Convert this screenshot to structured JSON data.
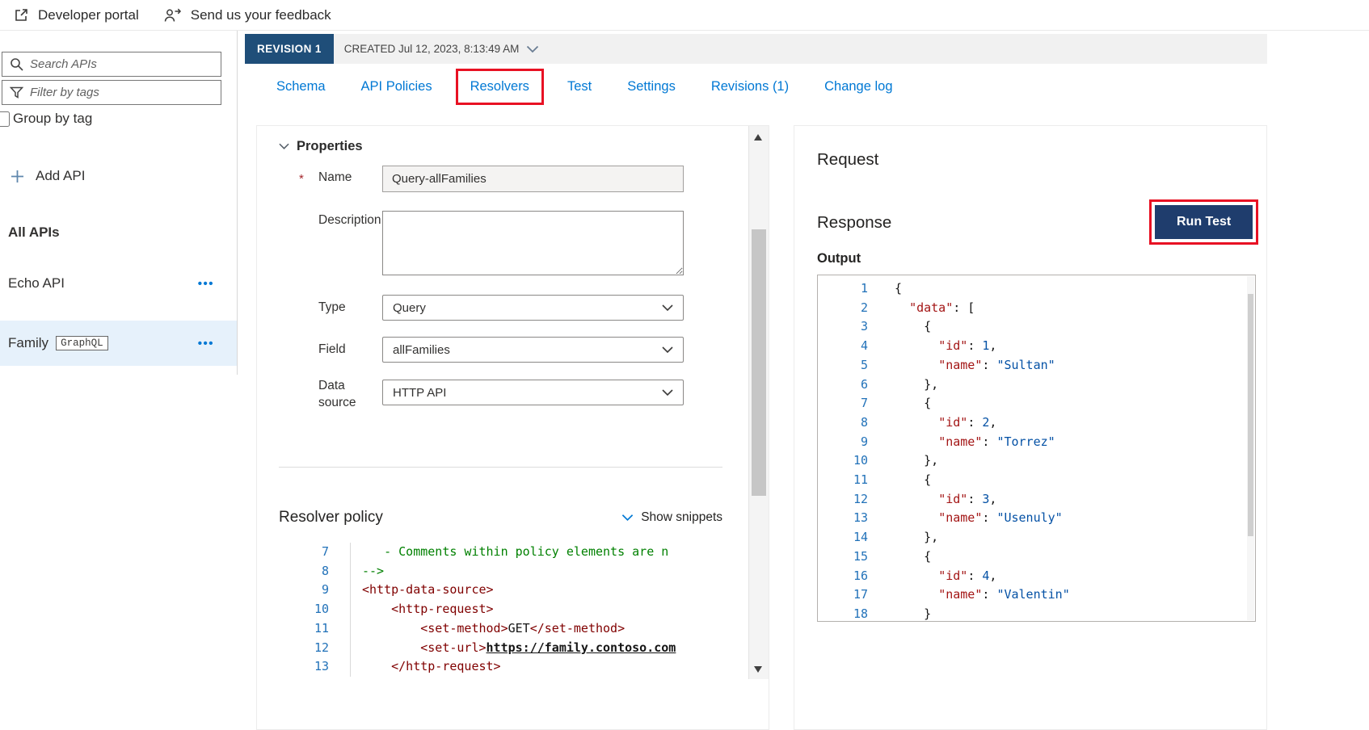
{
  "topbar": {
    "developer_portal": "Developer portal",
    "feedback": "Send us your feedback"
  },
  "sidebar": {
    "search_placeholder": "Search APIs",
    "filter_placeholder": "Filter by tags",
    "group_by_tag_label": "Group by tag",
    "add_api_label": "Add API",
    "all_apis_heading": "All APIs",
    "api_items": [
      {
        "label": "Echo API",
        "badge": null,
        "selected": false
      },
      {
        "label": "Family",
        "badge": "GraphQL",
        "selected": true
      }
    ]
  },
  "revision_bar": {
    "revision_label": "REVISION 1",
    "created_label": "CREATED Jul 12, 2023, 8:13:49 AM"
  },
  "tab_bar": {
    "tabs": [
      {
        "label": "Schema",
        "highlighted": false
      },
      {
        "label": "API Policies",
        "highlighted": false
      },
      {
        "label": "Resolvers",
        "highlighted": true
      },
      {
        "label": "Test",
        "highlighted": false
      },
      {
        "label": "Settings",
        "highlighted": false
      },
      {
        "label": "Revisions (1)",
        "highlighted": false
      },
      {
        "label": "Change log",
        "highlighted": false
      }
    ]
  },
  "properties_panel": {
    "section_title": "Properties",
    "fields": {
      "name": {
        "label": "Name",
        "required_marker": "*",
        "value": "Query-allFamilies",
        "disabled": true
      },
      "description": {
        "label": "Description",
        "value": ""
      },
      "type": {
        "label": "Type",
        "value": "Query"
      },
      "field": {
        "label": "Field",
        "value": "allFamilies"
      },
      "data_source": {
        "label": "Data source",
        "value": "HTTP API"
      }
    },
    "resolver_policy": {
      "title": "Resolver policy",
      "show_snippets_label": "Show snippets",
      "code_lines": [
        {
          "n": 7,
          "tokens": [
            {
              "c": "comment",
              "t": "   - Comments within policy elements are n"
            }
          ]
        },
        {
          "n": 8,
          "tokens": [
            {
              "c": "comment",
              "t": "-->"
            }
          ]
        },
        {
          "n": 9,
          "tokens": [
            {
              "c": "tag",
              "t": "<http-data-source>"
            }
          ]
        },
        {
          "n": 10,
          "tokens": [
            {
              "c": "plain",
              "t": "    "
            },
            {
              "c": "tag",
              "t": "<http-request>"
            }
          ]
        },
        {
          "n": 11,
          "tokens": [
            {
              "c": "plain",
              "t": "        "
            },
            {
              "c": "tag",
              "t": "<set-method>"
            },
            {
              "c": "plain",
              "t": "GET"
            },
            {
              "c": "tag",
              "t": "</set-method>"
            }
          ]
        },
        {
          "n": 12,
          "tokens": [
            {
              "c": "plain",
              "t": "        "
            },
            {
              "c": "tag",
              "t": "<set-url>"
            },
            {
              "c": "url",
              "t": "https://family.contoso.com"
            }
          ]
        },
        {
          "n": 13,
          "tokens": [
            {
              "c": "plain",
              "t": "    "
            },
            {
              "c": "tag",
              "t": "</http-request>"
            }
          ]
        }
      ]
    }
  },
  "test_panel": {
    "request_title": "Request",
    "response_title": "Response",
    "run_test_label": "Run Test",
    "output_label": "Output",
    "output_lines": [
      {
        "n": 1,
        "tokens": [
          {
            "c": "plain",
            "t": "{"
          }
        ]
      },
      {
        "n": 2,
        "tokens": [
          {
            "c": "plain",
            "t": "  "
          },
          {
            "c": "key",
            "t": "\"data\""
          },
          {
            "c": "plain",
            "t": ": ["
          }
        ]
      },
      {
        "n": 3,
        "tokens": [
          {
            "c": "plain",
            "t": "    {"
          }
        ]
      },
      {
        "n": 4,
        "tokens": [
          {
            "c": "plain",
            "t": "      "
          },
          {
            "c": "key",
            "t": "\"id\""
          },
          {
            "c": "plain",
            "t": ": "
          },
          {
            "c": "num",
            "t": "1"
          },
          {
            "c": "plain",
            "t": ","
          }
        ]
      },
      {
        "n": 5,
        "tokens": [
          {
            "c": "plain",
            "t": "      "
          },
          {
            "c": "key",
            "t": "\"name\""
          },
          {
            "c": "plain",
            "t": ": "
          },
          {
            "c": "str",
            "t": "\"Sultan\""
          }
        ]
      },
      {
        "n": 6,
        "tokens": [
          {
            "c": "plain",
            "t": "    },"
          }
        ]
      },
      {
        "n": 7,
        "tokens": [
          {
            "c": "plain",
            "t": "    {"
          }
        ]
      },
      {
        "n": 8,
        "tokens": [
          {
            "c": "plain",
            "t": "      "
          },
          {
            "c": "key",
            "t": "\"id\""
          },
          {
            "c": "plain",
            "t": ": "
          },
          {
            "c": "num",
            "t": "2"
          },
          {
            "c": "plain",
            "t": ","
          }
        ]
      },
      {
        "n": 9,
        "tokens": [
          {
            "c": "plain",
            "t": "      "
          },
          {
            "c": "key",
            "t": "\"name\""
          },
          {
            "c": "plain",
            "t": ": "
          },
          {
            "c": "str",
            "t": "\"Torrez\""
          }
        ]
      },
      {
        "n": 10,
        "tokens": [
          {
            "c": "plain",
            "t": "    },"
          }
        ]
      },
      {
        "n": 11,
        "tokens": [
          {
            "c": "plain",
            "t": "    {"
          }
        ]
      },
      {
        "n": 12,
        "tokens": [
          {
            "c": "plain",
            "t": "      "
          },
          {
            "c": "key",
            "t": "\"id\""
          },
          {
            "c": "plain",
            "t": ": "
          },
          {
            "c": "num",
            "t": "3"
          },
          {
            "c": "plain",
            "t": ","
          }
        ]
      },
      {
        "n": 13,
        "tokens": [
          {
            "c": "plain",
            "t": "      "
          },
          {
            "c": "key",
            "t": "\"name\""
          },
          {
            "c": "plain",
            "t": ": "
          },
          {
            "c": "str",
            "t": "\"Usenuly\""
          }
        ]
      },
      {
        "n": 14,
        "tokens": [
          {
            "c": "plain",
            "t": "    },"
          }
        ]
      },
      {
        "n": 15,
        "tokens": [
          {
            "c": "plain",
            "t": "    {"
          }
        ]
      },
      {
        "n": 16,
        "tokens": [
          {
            "c": "plain",
            "t": "      "
          },
          {
            "c": "key",
            "t": "\"id\""
          },
          {
            "c": "plain",
            "t": ": "
          },
          {
            "c": "num",
            "t": "4"
          },
          {
            "c": "plain",
            "t": ","
          }
        ]
      },
      {
        "n": 17,
        "tokens": [
          {
            "c": "plain",
            "t": "      "
          },
          {
            "c": "key",
            "t": "\"name\""
          },
          {
            "c": "plain",
            "t": ": "
          },
          {
            "c": "str",
            "t": "\"Valentin\""
          }
        ]
      },
      {
        "n": 18,
        "tokens": [
          {
            "c": "plain",
            "t": "    }"
          }
        ]
      }
    ]
  },
  "icons": [
    "open-in-new-icon",
    "feedback-icon",
    "search-icon",
    "filter-icon",
    "plus-icon",
    "chevron-down-icon",
    "more-options-icon",
    "scroll-up-icon",
    "scroll-down-icon"
  ],
  "colors": {
    "accent": "#0078d4",
    "highlight_red": "#e81123",
    "revision_bg": "#1f4e79",
    "runtest_bg": "#1f3d6d",
    "selected_bg": "#e6f1fb",
    "line_num": "#2272b9",
    "code_comment": "#008000",
    "code_tag": "#800000",
    "code_key": "#a31515",
    "code_str": "#0451a5",
    "code_numval": "#0451a5"
  }
}
